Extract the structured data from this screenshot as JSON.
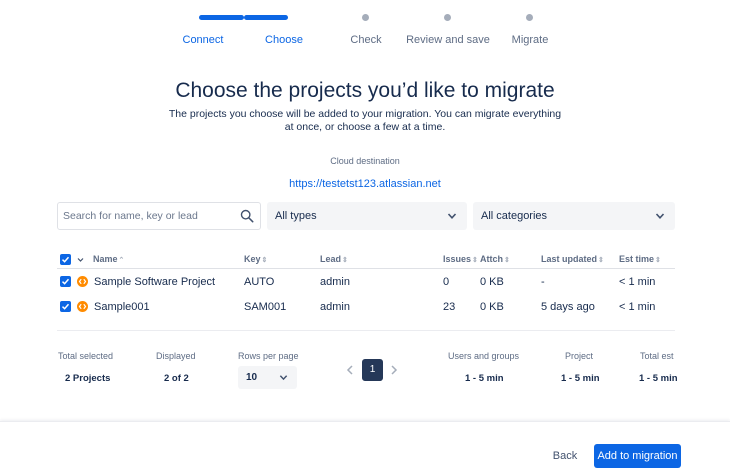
{
  "stepper": {
    "steps": [
      {
        "label": "Connect"
      },
      {
        "label": "Choose"
      },
      {
        "label": "Check"
      },
      {
        "label": "Review and save"
      },
      {
        "label": "Migrate"
      }
    ]
  },
  "header": {
    "title": "Choose the projects you’d like to migrate",
    "subtitle": "The projects you choose will be added to your migration. You can migrate everything at once, or choose a few at a time."
  },
  "destination": {
    "label": "Cloud destination",
    "url": "https://testetst123.atlassian.net"
  },
  "filters": {
    "search_placeholder": "Search for name, key or lead",
    "type_value": "All types",
    "category_value": "All categories"
  },
  "table": {
    "columns": {
      "name": "Name",
      "key": "Key",
      "lead": "Lead",
      "issues": "Issues",
      "attch": "Attch",
      "last_updated": "Last updated",
      "est_time": "Est time"
    },
    "rows": [
      {
        "name": "Sample Software Project",
        "key": "AUTO",
        "lead": "admin",
        "issues": "0",
        "attch": "0 KB",
        "last_updated": "-",
        "est_time": "< 1 min"
      },
      {
        "name": "Sample001",
        "key": "SAM001",
        "lead": "admin",
        "issues": "23",
        "attch": "0 KB",
        "last_updated": "5 days ago",
        "est_time": "< 1 min"
      }
    ]
  },
  "summary": {
    "total_selected_label": "Total selected",
    "total_selected_value": "2 Projects",
    "displayed_label": "Displayed",
    "displayed_value": "2 of 2",
    "rows_per_page_label": "Rows per page",
    "rows_per_page_value": "10",
    "current_page": "1",
    "users_groups_label": "Users and groups",
    "users_groups_value": "1 - 5 min",
    "project_label": "Project",
    "project_value": "1 - 5 min",
    "total_est_label": "Total est",
    "total_est_value": "1 - 5 min"
  },
  "footer": {
    "back_label": "Back",
    "add_label": "Add to migration"
  },
  "colors": {
    "accent": "#0c66e4",
    "text": "#172b4d",
    "muted": "#5e6c84",
    "project_icon": "#ff8b00",
    "pagination_active": "#253858"
  }
}
